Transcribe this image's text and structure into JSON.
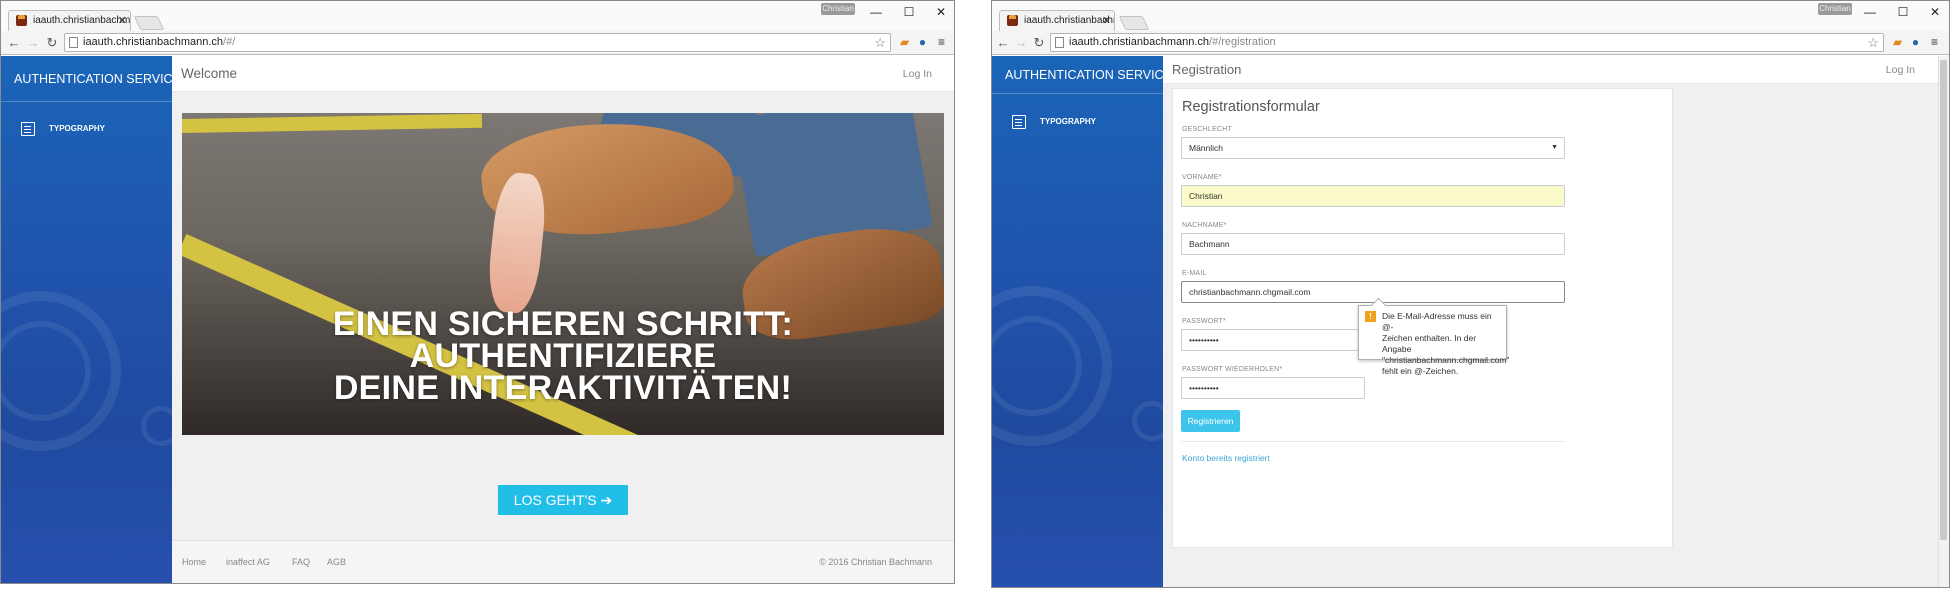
{
  "window1": {
    "tab_title": "iaauth.christianbachmann.",
    "user_button": "Christian",
    "address": {
      "host": "iaauth.christianbachmann.ch",
      "path": "/#/"
    },
    "sidebar": {
      "brand": "AUTHENTICATION SERVICE",
      "items": [
        {
          "label": "TYPOGRAPHY",
          "icon": "book-icon"
        }
      ]
    },
    "header": {
      "title": "Welcome",
      "login": "Log In"
    },
    "hero": {
      "line1": "EINEN SICHEREN SCHRITT:",
      "line2": "AUTHENTIFIZIERE",
      "line3": "DEINE INTERAKTIVITÄTEN!",
      "button": "LOS GEHT'S ➔"
    },
    "footer": {
      "links": [
        "Home",
        "inaffect AG",
        "FAQ",
        "AGB"
      ],
      "copyright": "© 2016 Christian Bachmann"
    }
  },
  "window2": {
    "tab_title": "iaauth.christianbachmann.",
    "user_button": "Christian",
    "address": {
      "host": "iaauth.christianbachmann.ch",
      "path": "/#/registration"
    },
    "sidebar": {
      "brand": "AUTHENTICATION SERVICE",
      "items": [
        {
          "label": "TYPOGRAPHY",
          "icon": "book-icon"
        }
      ]
    },
    "header": {
      "title": "Registration",
      "login": "Log In"
    },
    "form": {
      "title": "Registrationsformular",
      "gender_label": "GESCHLECHT",
      "gender_value": "Männlich",
      "firstname_label": "VORNAME*",
      "firstname_value": "Christian",
      "lastname_label": "NACHNAME*",
      "lastname_value": "Bachmann",
      "email_label": "E-MAIL",
      "email_value": "christianbachmann.chgmail.com",
      "password_label": "PASSWORT*",
      "password_value": "••••••••••",
      "password_repeat_label": "PASSWORT WIEDERHOLEN*",
      "password_repeat_value": "••••••••••",
      "submit": "Registrieren",
      "login_link": "Konto bereits registriert"
    },
    "validation_tooltip": {
      "icon": "!",
      "line1": "Die E-Mail-Adresse muss ein @-",
      "line2": "Zeichen enthalten. In der Angabe",
      "line3": "\"christianbachmann.chgmail.com\"",
      "line4": "fehlt ein @-Zeichen."
    }
  },
  "colors": {
    "sidebar": "#1f56ad",
    "accent": "#21bfe8",
    "autofill": "#fbfbc9",
    "warning": "#f0a21b"
  }
}
